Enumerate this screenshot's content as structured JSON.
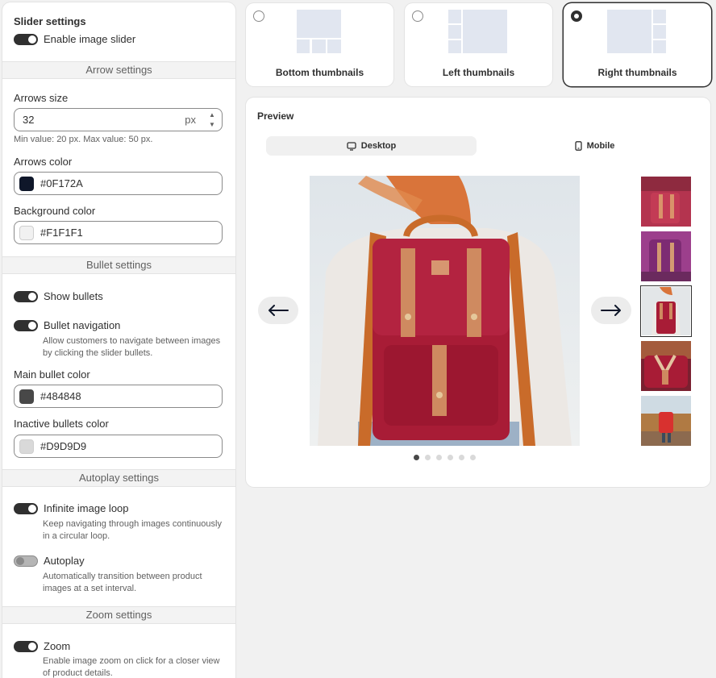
{
  "sidebar": {
    "slider_settings_title": "Slider settings",
    "enable_slider_label": "Enable image slider",
    "arrow_section": "Arrow settings",
    "arrows_size_label": "Arrows size",
    "arrows_size_value": "32",
    "arrows_size_unit": "px",
    "arrows_size_help": "Min value: 20 px. Max value: 50 px.",
    "arrows_color_label": "Arrows color",
    "arrows_color_value": "#0F172A",
    "background_color_label": "Background color",
    "background_color_value": "#F1F1F1",
    "bullet_section": "Bullet settings",
    "show_bullets_label": "Show bullets",
    "bullet_navigation_label": "Bullet navigation",
    "bullet_navigation_help": "Allow customers to navigate between images by clicking the slider bullets.",
    "main_bullet_label": "Main bullet color",
    "main_bullet_value": "#484848",
    "inactive_bullets_label": "Inactive bullets color",
    "inactive_bullets_value": "#D9D9D9",
    "autoplay_section": "Autoplay settings",
    "infinite_loop_label": "Infinite image loop",
    "infinite_loop_help": "Keep navigating through images continuously in a circular loop.",
    "autoplay_label": "Autoplay",
    "autoplay_help": "Automatically transition between product images at a set interval.",
    "zoom_section": "Zoom settings",
    "zoom_label": "Zoom",
    "zoom_help": "Enable image zoom on click for a closer view of product details."
  },
  "toggles": {
    "enable_slider": true,
    "show_bullets": true,
    "bullet_navigation": true,
    "infinite_loop": true,
    "autoplay": false,
    "zoom": true
  },
  "layouts": [
    {
      "label": "Bottom thumbnails",
      "selected": false
    },
    {
      "label": "Left thumbnails",
      "selected": false
    },
    {
      "label": "Right thumbnails",
      "selected": true
    }
  ],
  "preview": {
    "title": "Preview",
    "tab_desktop": "Desktop",
    "tab_mobile": "Mobile",
    "active_tab": "Desktop",
    "bullet_count": 6,
    "active_bullet": 1,
    "selected_thumbnail": 3
  },
  "colors": {
    "arrows": "#0F172A",
    "arrow_background": "#F1F1F1",
    "main_bullet": "#484848",
    "inactive_bullet": "#D9D9D9"
  },
  "icons": [
    "arrow-left-icon",
    "arrow-right-icon",
    "desktop-icon",
    "mobile-icon"
  ]
}
